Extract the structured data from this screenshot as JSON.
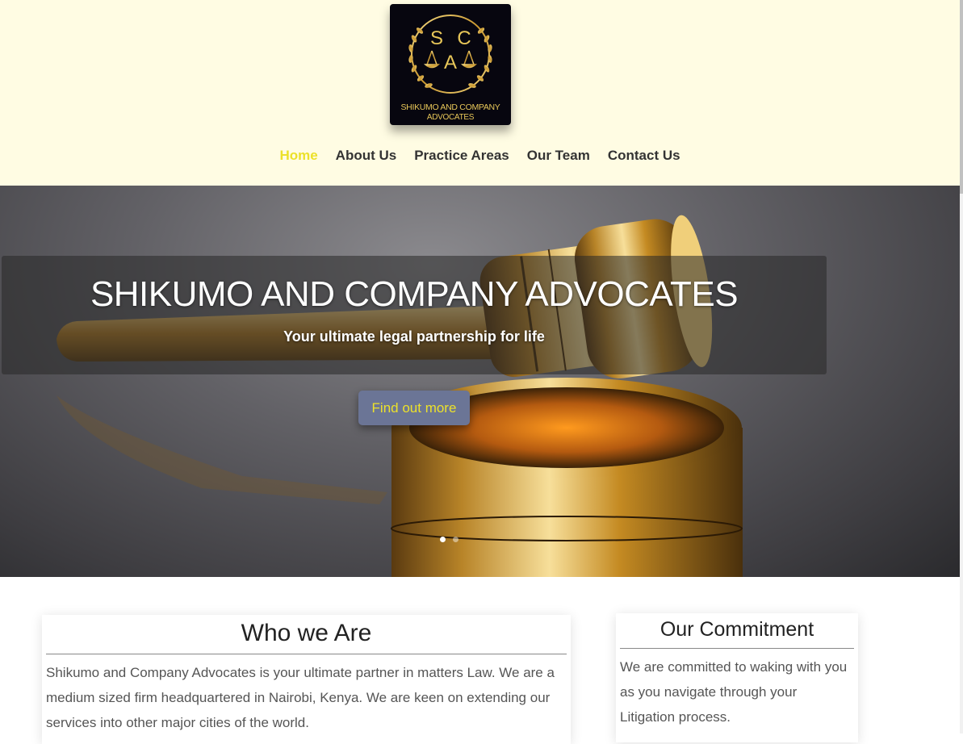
{
  "logo": {
    "letters": [
      "S",
      "C",
      "A"
    ],
    "name_line1": "SHIKUMO AND COMPANY",
    "name_line2": "ADVOCATES"
  },
  "nav": {
    "items": [
      {
        "label": "Home",
        "active": true
      },
      {
        "label": "About Us",
        "active": false
      },
      {
        "label": "Practice Areas",
        "active": false
      },
      {
        "label": "Our Team",
        "active": false
      },
      {
        "label": "Contact Us",
        "active": false
      }
    ]
  },
  "hero": {
    "title": "SHIKUMO AND COMPANY ADVOCATES",
    "subtitle": "Your ultimate legal partnership for life",
    "button_label": "Find out more",
    "slides_count": 2,
    "active_slide": 1
  },
  "who_we_are": {
    "title": "Who we Are",
    "text": "Shikumo and Company Advocates is your ultimate partner in matters Law. We are a medium sized firm headquartered in Nairobi, Kenya. We are keen on extending our services into other major cities of the world."
  },
  "commitment": {
    "title": "Our Commitment",
    "text": "We are committed to waking with you as you navigate through your Litigation process."
  },
  "colors": {
    "header_bg": "#fffce3",
    "accent_yellow": "#ece12a",
    "nav_text": "#333333",
    "button_bg": "#6b7596",
    "logo_bg": "#07060f",
    "logo_gold": "#e7c659"
  },
  "icons": [
    "scales-of-justice-icon",
    "laurel-wreath-icon"
  ]
}
